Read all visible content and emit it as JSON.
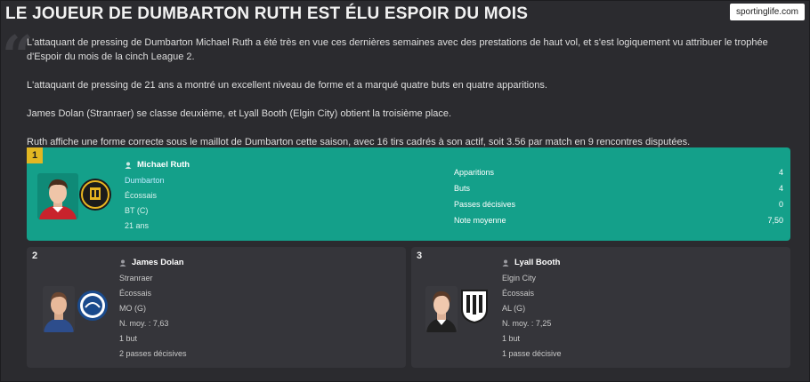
{
  "header": {
    "title": "LE JOUEUR DE DUMBARTON RUTH EST ÉLU ESPOIR DU MOIS",
    "source": "sportinglife.com"
  },
  "article": {
    "p1": "L'attaquant de pressing de Dumbarton Michael Ruth a été très en vue ces dernières semaines avec des prestations de haut vol, et s'est logiquement vu attribuer le trophée d'Espoir du mois de la cinch League 2.",
    "p2": "L'attaquant de pressing de 21 ans a montré un excellent niveau de forme et a marqué quatre buts en quatre apparitions.",
    "p3": "James Dolan (Stranraer) se classe deuxième, et Lyall Booth (Elgin City) obtient la troisième place.",
    "p4": "Ruth affiche une forme correcte sous le maillot de Dumbarton cette saison, avec 16 tirs cadrés à son actif, soit 3.56 par match en 9 rencontres disputées."
  },
  "winner": {
    "rank": "1",
    "name": "Michael Ruth",
    "club": "Dumbarton",
    "nationality": "Écossais",
    "position": "BT (C)",
    "age": "21 ans",
    "stats": [
      {
        "label": "Apparitions",
        "value": "4"
      },
      {
        "label": "Buts",
        "value": "4"
      },
      {
        "label": "Passes décisives",
        "value": "0"
      },
      {
        "label": "Note moyenne",
        "value": "7,50"
      }
    ]
  },
  "second": {
    "rank": "2",
    "name": "James Dolan",
    "club": "Stranraer",
    "nationality": "Écossais",
    "position": "MO (G)",
    "rating": "N. moy. : 7,63",
    "goals": "1 but",
    "assists": "2 passes décisives"
  },
  "third": {
    "rank": "3",
    "name": "Lyall Booth",
    "club": "Elgin City",
    "nationality": "Écossais",
    "position": "AL (G)",
    "rating": "N. moy. : 7,25",
    "goals": "1 but",
    "assists": "1 passe décisive"
  },
  "colors": {
    "winner_bg": "#14a08a",
    "rank_gold": "#e2b722",
    "card_bg": "#35353a",
    "page_bg": "#2b2b2f"
  }
}
